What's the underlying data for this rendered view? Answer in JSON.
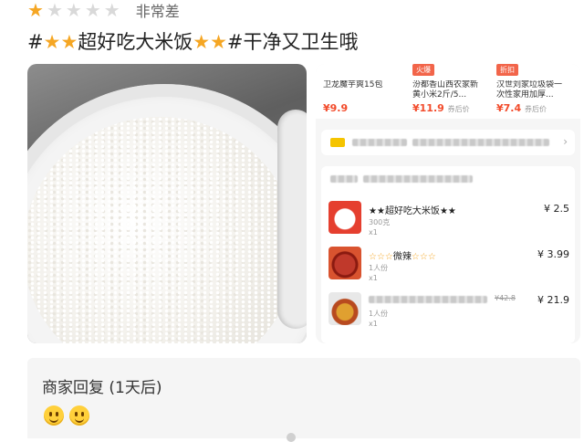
{
  "rating": {
    "stars_filled": 1,
    "stars_total": 5,
    "label": "非常差",
    "star_glyph": "★",
    "accent": "#f5a623"
  },
  "review": {
    "title_prefix": "#★★",
    "title_food": "超好吃大米饭",
    "title_stars": "★★",
    "title_suffix": "#干净又卫生哦"
  },
  "order_screenshot": {
    "recommendations": [
      {
        "tag": "",
        "name": "卫龙魔芋爽15包",
        "price": "¥9.9",
        "price_note": ""
      },
      {
        "tag": "火爆",
        "name": "汾都香山西农家新黄小米2斤/5...",
        "price": "¥11.9",
        "price_note": "券后价"
      },
      {
        "tag": "折扣",
        "name": "汉世刘家垃圾袋一次性家用加厚...",
        "price": "¥7.4",
        "price_note": "券后价"
      }
    ],
    "items": [
      {
        "name_stars_left": "★★",
        "name": "超好吃大米饭",
        "name_stars_right": "★★",
        "spec": "300克",
        "qty": "x1",
        "price": "¥ 2.5"
      },
      {
        "name_stars_left": "☆☆☆",
        "name": "微辣",
        "name_stars_right": "☆☆☆",
        "spec": "1人份",
        "qty": "x1",
        "price": "¥ 3.99"
      },
      {
        "name_stars_left": "",
        "name": "",
        "name_stars_right": "",
        "spec": "1人份",
        "qty": "x1",
        "price": "¥ 21.9",
        "old_price": "¥42.8"
      }
    ]
  },
  "merchant_reply": {
    "label": "商家回复 (1天后)",
    "emoji_count": 2,
    "emoji_name": "smile-emoji"
  },
  "colors": {
    "price_red": "#f24b2b",
    "tag_orange": "#f2654a"
  }
}
